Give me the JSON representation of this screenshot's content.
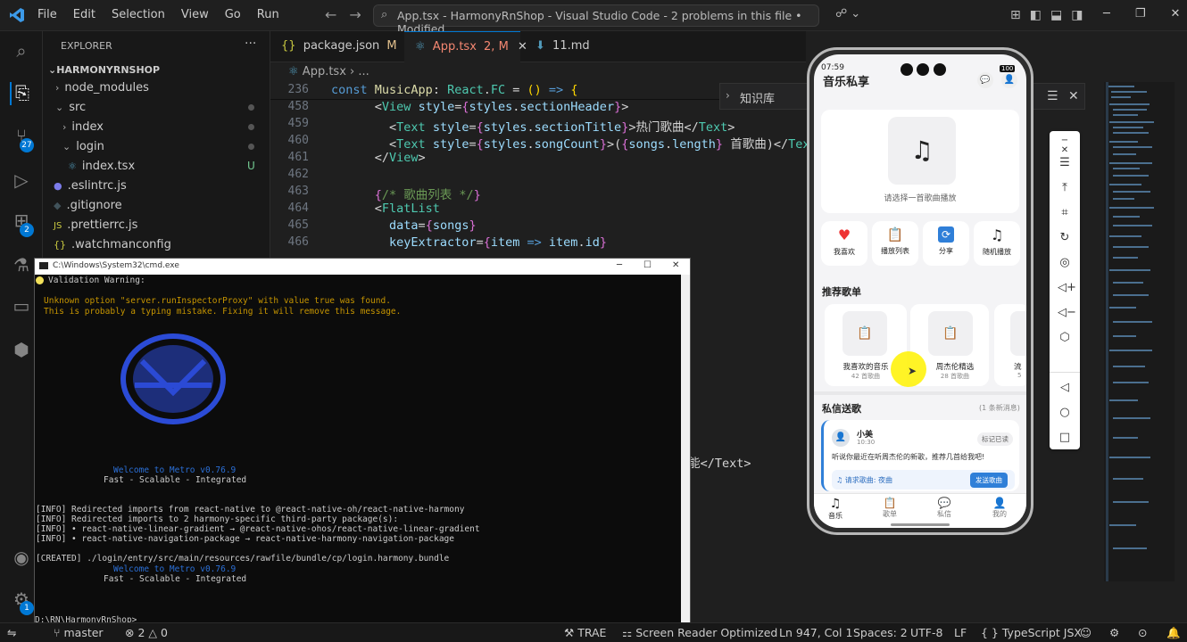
{
  "titlebar": {
    "menus": [
      "File",
      "Edit",
      "Selection",
      "View",
      "Go",
      "Run"
    ],
    "search_text": "App.tsx - HarmonyRnShop - Visual Studio Code - 2 problems in this file • Modified"
  },
  "activity": {
    "source_control_badge": "27",
    "extensions_badge": "2",
    "settings_badge": "1"
  },
  "explorer": {
    "header": "EXPLORER",
    "root": "HARMONYRNSHOP",
    "items": [
      {
        "label": "node_modules"
      },
      {
        "label": "src"
      },
      {
        "label": "index"
      },
      {
        "label": "login"
      },
      {
        "label": "index.tsx",
        "status": "U"
      },
      {
        "label": ".eslintrc.js"
      },
      {
        "label": ".gitignore"
      },
      {
        "label": ".prettierrc.js"
      },
      {
        "label": ".watchmanconfig"
      }
    ]
  },
  "tabs": [
    {
      "icon": "{}",
      "label": "package.json",
      "status": "M"
    },
    {
      "label": "App.tsx",
      "status": "2, M"
    },
    {
      "label": "11.md"
    }
  ],
  "breadcrumb": {
    "file": "App.tsx",
    "rest": "..."
  },
  "editor": {
    "sticky_line_no": "236",
    "line_numbers": [
      "458",
      "459",
      "460",
      "461",
      "462",
      "463",
      "464",
      "465",
      "466"
    ],
    "partial_line": "ا能</Text>"
  },
  "knowledge_panel": {
    "title": "知识库"
  },
  "phone": {
    "time": "07:59",
    "battery": "100",
    "title": "音乐私享",
    "player_prompt": "请选择一首歌曲播放",
    "actions": [
      {
        "icon": "heart-icon",
        "label": "我喜欢"
      },
      {
        "icon": "clipboard-icon",
        "label": "播放列表"
      },
      {
        "icon": "refresh-icon",
        "label": "分享"
      },
      {
        "icon": "note-icon",
        "label": "随机播放"
      }
    ],
    "section_recommend": "推荐歌单",
    "playlists": [
      {
        "name": "我喜欢的音乐",
        "count": "42 首歌曲"
      },
      {
        "name": "周杰伦精选",
        "count": "28 首歌曲"
      },
      {
        "name": "流",
        "count": "5"
      }
    ],
    "section_messages": "私信送歌",
    "messages_count": "(1 条新消息)",
    "message": {
      "sender": "小美",
      "time": "10:30",
      "mark_read": "标记已读",
      "text": "听说你最近在听周杰伦的新歌，推荐几首给我吧!",
      "request": "请求歌曲: 夜曲",
      "send_button": "发送歌曲"
    },
    "bottom_nav": [
      "音乐",
      "歌单",
      "私信",
      "我的"
    ]
  },
  "cmd": {
    "title": "C:\\Windows\\System32\\cmd.exe",
    "warning_title": "Validation Warning:",
    "warning_1": "Unknown option \"server.runInspectorProxy\" with value true was found.",
    "warning_2": "This is probably a typing mistake. Fixing it will remove this message.",
    "welcome_1": "Welcome to Metro v0.76.9",
    "tagline_1": "Fast - Scalable - Integrated",
    "info_1": "[INFO] Redirected imports from react-native to @react-native-oh/react-native-harmony",
    "info_2": "[INFO] Redirected imports to 2 harmony-specific third-party package(s):",
    "info_3": "[INFO] • react-native-linear-gradient → @react-native-ohos/react-native-linear-gradient",
    "info_4": "[INFO] • react-native-navigation-package → react-native-harmony-navigation-package",
    "created": "[CREATED] ./login/entry/src/main/resources/rawfile/bundle/cp/login.harmony.bundle",
    "welcome_2": "Welcome to Metro v0.76.9",
    "tagline_2": "Fast - Scalable - Integrated",
    "prompt": "D:\\RN\\HarmonyRnShop>"
  },
  "statusbar": {
    "branch": "master",
    "problems": "2 △ 0",
    "trae": "TRAE",
    "reader": "Screen Reader Optimized",
    "position": "Ln 947, Col 1",
    "spaces": "Spaces: 2",
    "encoding": "UTF-8",
    "eol": "LF",
    "language": "TypeScript JSX"
  }
}
